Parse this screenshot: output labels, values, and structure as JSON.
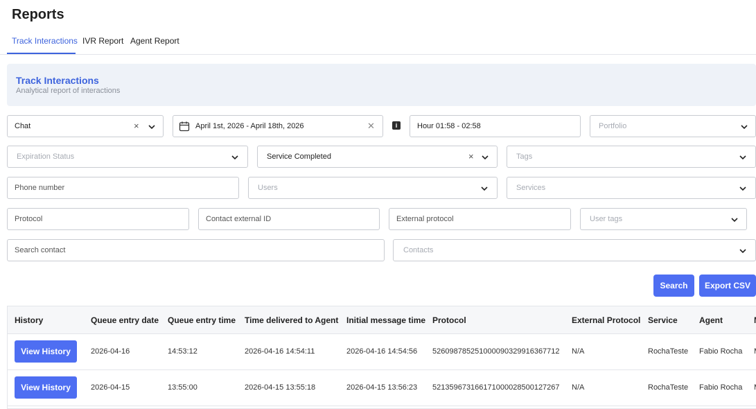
{
  "page": {
    "title": "Reports"
  },
  "tabs": [
    {
      "label": "Track Interactions",
      "active": true
    },
    {
      "label": "IVR Report",
      "active": false
    },
    {
      "label": "Agent Report",
      "active": false
    }
  ],
  "banner": {
    "title": "Track Interactions",
    "subtitle": "Analytical report of interactions"
  },
  "filters": {
    "channel": {
      "value": "Chat"
    },
    "date_range": {
      "value": "April 1st, 2026 - April 18th, 2026"
    },
    "hour": {
      "value": "Hour 01:58 - 02:58"
    },
    "portfolio": {
      "placeholder": "Portfolio"
    },
    "expiration_status": {
      "placeholder": "Expiration Status"
    },
    "service_status": {
      "value": "Service Completed"
    },
    "tags": {
      "placeholder": "Tags"
    },
    "phone_number": {
      "placeholder": "Phone number"
    },
    "users": {
      "placeholder": "Users"
    },
    "services": {
      "placeholder": "Services"
    },
    "protocol": {
      "placeholder": "Protocol"
    },
    "contact_external_id": {
      "placeholder": "Contact external ID"
    },
    "external_protocol": {
      "placeholder": "External protocol"
    },
    "user_tags": {
      "placeholder": "User tags"
    },
    "search_contact": {
      "placeholder": "Search contact"
    },
    "contacts": {
      "placeholder": "Contacts"
    }
  },
  "actions": {
    "search_label": "Search",
    "export_label": "Export CSV"
  },
  "table": {
    "columns": [
      "History",
      "Queue entry date",
      "Queue entry time",
      "Time delivered to Agent",
      "Initial message time",
      "Protocol",
      "External Protocol",
      "Service",
      "Agent",
      "M"
    ],
    "rows": [
      {
        "history": "View History",
        "queue_date": "2026-04-16",
        "queue_time": "14:53:12",
        "delivered": "2026-04-16 14:54:11",
        "initial_msg": "2026-04-16 14:54:56",
        "protocol": "5260987852510000903299163677​12",
        "external_protocol": "N/A",
        "service": "RochaTeste",
        "agent": "Fabio Rocha",
        "extra": "M"
      },
      {
        "history": "View History",
        "queue_date": "2026-04-15",
        "queue_time": "13:55:00",
        "delivered": "2026-04-15 13:55:18",
        "initial_msg": "2026-04-15 13:56:23",
        "protocol": "5213596731661710000285001272​67",
        "external_protocol": "N/A",
        "service": "RochaTeste",
        "agent": "Fabio Rocha",
        "extra": "M"
      }
    ]
  },
  "colors": {
    "accent": "#3d63dd",
    "button": "#4e6ef2",
    "banner_bg": "#eef2f8"
  }
}
